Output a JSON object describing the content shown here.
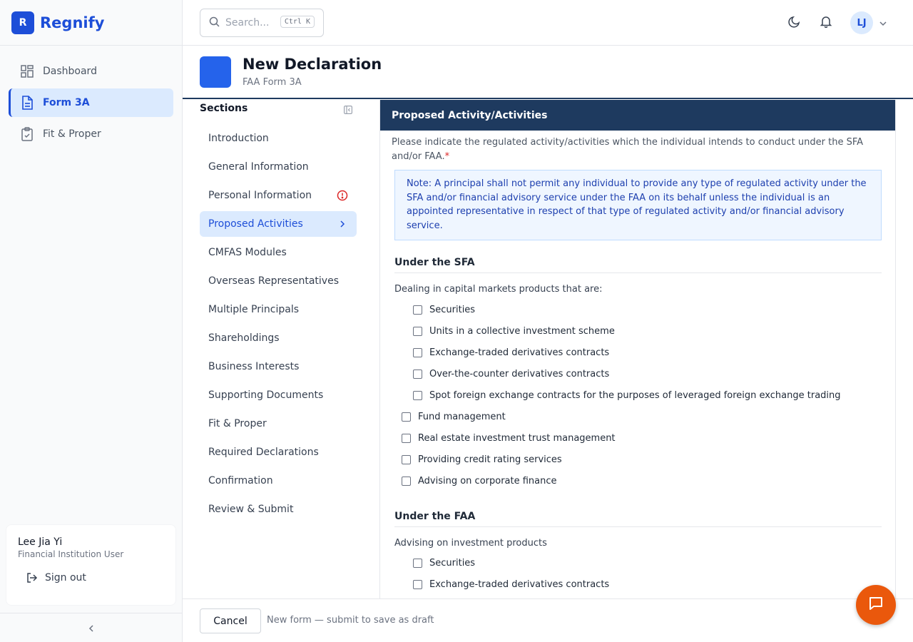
{
  "brand": {
    "logo_letter": "R",
    "name": "Regnify"
  },
  "nav": {
    "items": [
      {
        "label": "Dashboard",
        "icon": "dashboard-icon",
        "active": false
      },
      {
        "label": "Form 3A",
        "icon": "document-icon",
        "active": true
      },
      {
        "label": "Fit & Proper",
        "icon": "clipboard-check-icon",
        "active": false
      }
    ]
  },
  "user": {
    "name": "Lee Jia Yi",
    "role": "Financial Institution User",
    "signout_label": "Sign out",
    "initials": "LJ"
  },
  "search": {
    "placeholder": "Search...",
    "shortcut": "Ctrl K"
  },
  "page": {
    "title": "New Declaration",
    "subtitle": "FAA Form 3A"
  },
  "sections": {
    "title": "Sections",
    "items": [
      {
        "label": "Introduction"
      },
      {
        "label": "General Information"
      },
      {
        "label": "Personal Information",
        "status": "error"
      },
      {
        "label": "Proposed Activities",
        "active": true
      },
      {
        "label": "CMFAS Modules"
      },
      {
        "label": "Overseas Representatives"
      },
      {
        "label": "Multiple Principals"
      },
      {
        "label": "Shareholdings"
      },
      {
        "label": "Business Interests"
      },
      {
        "label": "Supporting Documents"
      },
      {
        "label": "Fit & Proper"
      },
      {
        "label": "Required Declarations"
      },
      {
        "label": "Confirmation"
      },
      {
        "label": "Review & Submit"
      }
    ]
  },
  "form": {
    "header": "Proposed Activity/Activities",
    "instruction": "Please indicate the regulated activity/activities which the individual intends to conduct under the SFA and/or FAA.",
    "required_mark": "*",
    "note": "Note: A principal shall not permit any individual to provide any type of regulated activity under the SFA and/or financial advisory service under the FAA on its behalf unless the individual is an appointed representative in respect of that type of regulated activity and/or financial advisory service.",
    "sfa": {
      "heading": "Under the SFA",
      "group_label": "Dealing in capital markets products that are:",
      "sub_options": [
        "Securities",
        "Units in a collective investment scheme",
        "Exchange-traded derivatives contracts",
        "Over-the-counter derivatives contracts",
        "Spot foreign exchange contracts for the purposes of leveraged foreign exchange trading"
      ],
      "options": [
        "Fund management",
        "Real estate investment trust management",
        "Providing credit rating services",
        "Advising on corporate finance"
      ]
    },
    "faa": {
      "heading": "Under the FAA",
      "group_label": "Advising on investment products",
      "sub_options": [
        "Securities",
        "Exchange-traded derivatives contracts"
      ]
    }
  },
  "footer": {
    "cancel_label": "Cancel",
    "note": "New form — submit to save as draft"
  },
  "colors": {
    "brand": "#1d4ed8",
    "form_header": "#1e3a5f",
    "chat_button": "#ea580c",
    "error": "#dc2626"
  }
}
